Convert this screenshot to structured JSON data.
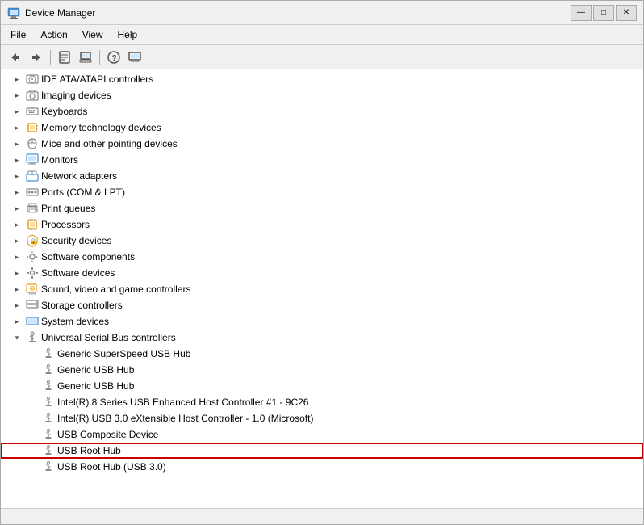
{
  "window": {
    "title": "Device Manager",
    "minimize_label": "—",
    "maximize_label": "□",
    "close_label": "✕"
  },
  "menu": {
    "items": [
      {
        "label": "File"
      },
      {
        "label": "Action"
      },
      {
        "label": "View"
      },
      {
        "label": "Help"
      }
    ]
  },
  "toolbar": {
    "buttons": [
      {
        "name": "back",
        "icon": "◀"
      },
      {
        "name": "forward",
        "icon": "▶"
      },
      {
        "name": "properties",
        "icon": "📋"
      },
      {
        "name": "update",
        "icon": "🔄"
      },
      {
        "name": "help",
        "icon": "❓"
      },
      {
        "name": "uninstall",
        "icon": "🗑"
      },
      {
        "name": "display",
        "icon": "🖥"
      }
    ]
  },
  "tree": {
    "items": [
      {
        "id": "ide",
        "label": "IDE ATA/ATAPI controllers",
        "indent": 1,
        "expandable": true,
        "expanded": false,
        "icon": "disk"
      },
      {
        "id": "imaging",
        "label": "Imaging devices",
        "indent": 1,
        "expandable": true,
        "expanded": false,
        "icon": "camera"
      },
      {
        "id": "keyboards",
        "label": "Keyboards",
        "indent": 1,
        "expandable": true,
        "expanded": false,
        "icon": "keyboard"
      },
      {
        "id": "memory",
        "label": "Memory technology devices",
        "indent": 1,
        "expandable": true,
        "expanded": false,
        "icon": "chip"
      },
      {
        "id": "mice",
        "label": "Mice and other pointing devices",
        "indent": 1,
        "expandable": true,
        "expanded": false,
        "icon": "mouse"
      },
      {
        "id": "monitors",
        "label": "Monitors",
        "indent": 1,
        "expandable": true,
        "expanded": false,
        "icon": "monitor"
      },
      {
        "id": "network",
        "label": "Network adapters",
        "indent": 1,
        "expandable": true,
        "expanded": false,
        "icon": "network"
      },
      {
        "id": "ports",
        "label": "Ports (COM & LPT)",
        "indent": 1,
        "expandable": true,
        "expanded": false,
        "icon": "port"
      },
      {
        "id": "print",
        "label": "Print queues",
        "indent": 1,
        "expandable": true,
        "expanded": false,
        "icon": "printer"
      },
      {
        "id": "processors",
        "label": "Processors",
        "indent": 1,
        "expandable": true,
        "expanded": false,
        "icon": "cpu"
      },
      {
        "id": "security",
        "label": "Security devices",
        "indent": 1,
        "expandable": true,
        "expanded": false,
        "icon": "security"
      },
      {
        "id": "software-comp",
        "label": "Software components",
        "indent": 1,
        "expandable": true,
        "expanded": false,
        "icon": "gear"
      },
      {
        "id": "software-dev",
        "label": "Software devices",
        "indent": 1,
        "expandable": true,
        "expanded": false,
        "icon": "gear2"
      },
      {
        "id": "sound",
        "label": "Sound, video and game controllers",
        "indent": 1,
        "expandable": true,
        "expanded": false,
        "icon": "sound"
      },
      {
        "id": "storage",
        "label": "Storage controllers",
        "indent": 1,
        "expandable": true,
        "expanded": false,
        "icon": "storage"
      },
      {
        "id": "system",
        "label": "System devices",
        "indent": 1,
        "expandable": true,
        "expanded": false,
        "icon": "system"
      },
      {
        "id": "usb",
        "label": "Universal Serial Bus controllers",
        "indent": 1,
        "expandable": true,
        "expanded": true,
        "icon": "usb"
      },
      {
        "id": "usb-1",
        "label": "Generic SuperSpeed USB Hub",
        "indent": 2,
        "expandable": false,
        "expanded": false,
        "icon": "usb-device"
      },
      {
        "id": "usb-2",
        "label": "Generic USB Hub",
        "indent": 2,
        "expandable": false,
        "expanded": false,
        "icon": "usb-device"
      },
      {
        "id": "usb-3",
        "label": "Generic USB Hub",
        "indent": 2,
        "expandable": false,
        "expanded": false,
        "icon": "usb-device"
      },
      {
        "id": "usb-4",
        "label": "Intel(R) 8 Series USB Enhanced Host Controller #1 - 9C26",
        "indent": 2,
        "expandable": false,
        "expanded": false,
        "icon": "usb-device"
      },
      {
        "id": "usb-5",
        "label": "Intel(R) USB 3.0 eXtensible Host Controller - 1.0 (Microsoft)",
        "indent": 2,
        "expandable": false,
        "expanded": false,
        "icon": "usb-device"
      },
      {
        "id": "usb-6",
        "label": "USB Composite Device",
        "indent": 2,
        "expandable": false,
        "expanded": false,
        "icon": "usb-device"
      },
      {
        "id": "usb-7",
        "label": "USB Root Hub",
        "indent": 2,
        "expandable": false,
        "expanded": false,
        "icon": "usb-device",
        "highlighted": true
      },
      {
        "id": "usb-8",
        "label": "USB Root Hub (USB 3.0)",
        "indent": 2,
        "expandable": false,
        "expanded": false,
        "icon": "usb-device"
      }
    ]
  },
  "statusbar": {
    "text": ""
  }
}
